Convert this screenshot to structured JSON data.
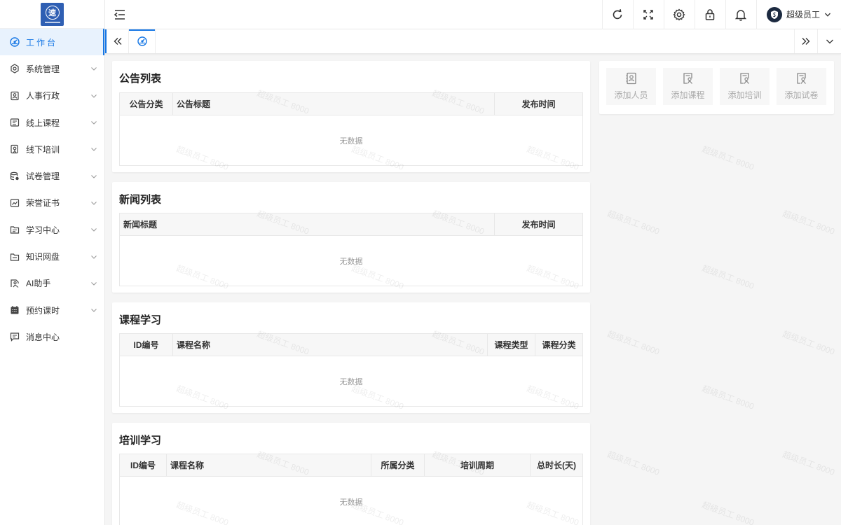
{
  "logo": {
    "glyph": "速"
  },
  "sidebar": {
    "items": [
      {
        "label": "工作台",
        "icon": "dashboard-icon",
        "active": true
      },
      {
        "label": "系统管理",
        "icon": "system-settings-icon"
      },
      {
        "label": "人事行政",
        "icon": "personnel-icon"
      },
      {
        "label": "线上课程",
        "icon": "online-course-icon"
      },
      {
        "label": "线下培训",
        "icon": "offline-training-icon"
      },
      {
        "label": "试卷管理",
        "icon": "exam-paper-icon"
      },
      {
        "label": "荣誉证书",
        "icon": "certificate-icon"
      },
      {
        "label": "学习中心",
        "icon": "learning-center-icon"
      },
      {
        "label": "知识网盘",
        "icon": "knowledge-drive-icon"
      },
      {
        "label": "AI助手",
        "icon": "ai-assistant-icon"
      },
      {
        "label": "预约课时",
        "icon": "calendar-icon"
      },
      {
        "label": "消息中心",
        "icon": "message-icon"
      }
    ]
  },
  "header": {
    "user_name": "超级员工",
    "icons": [
      "refresh-icon",
      "fullscreen-icon",
      "gear-icon",
      "lock-icon",
      "bell-icon"
    ]
  },
  "cards": {
    "announcements": {
      "title": "公告列表",
      "columns": [
        "公告分类",
        "公告标题",
        "发布时间"
      ],
      "empty": "无数据"
    },
    "news": {
      "title": "新闻列表",
      "columns": [
        "新闻标题",
        "发布时间"
      ],
      "empty": "无数据"
    },
    "courses": {
      "title": "课程学习",
      "columns": [
        "ID编号",
        "课程名称",
        "课程类型",
        "课程分类"
      ],
      "empty": "无数据"
    },
    "trainings": {
      "title": "培训学习",
      "columns": [
        "ID编号",
        "课程名称",
        "所属分类",
        "培训周期",
        "总时长(天)"
      ],
      "empty": "无数据"
    }
  },
  "quick_actions": [
    {
      "label": "添加人员",
      "icon": "add-person-icon"
    },
    {
      "label": "添加课程",
      "icon": "add-course-icon"
    },
    {
      "label": "添加培训",
      "icon": "add-training-icon"
    },
    {
      "label": "添加试卷",
      "icon": "add-exam-icon"
    }
  ],
  "watermark": "超级员工 8000"
}
